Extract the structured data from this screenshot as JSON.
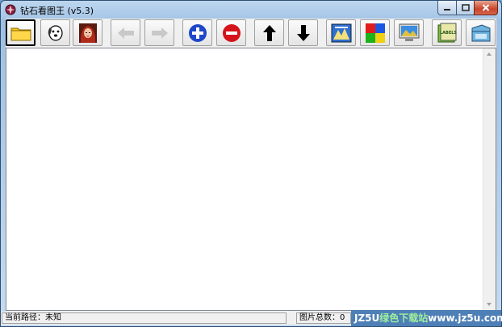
{
  "window": {
    "title": "钻石看图王 (v5.3)"
  },
  "toolbar": {
    "buttons": [
      {
        "name": "open-folder-button",
        "icon": "folder-icon"
      },
      {
        "name": "dog-button",
        "icon": "dog-icon"
      },
      {
        "name": "portrait-button",
        "icon": "portrait-icon"
      },
      {
        "name": "previous-button",
        "icon": "arrow-left-icon"
      },
      {
        "name": "next-button",
        "icon": "arrow-right-icon"
      },
      {
        "name": "zoom-in-button",
        "icon": "plus-circle-icon"
      },
      {
        "name": "zoom-out-button",
        "icon": "minus-circle-icon"
      },
      {
        "name": "move-up-button",
        "icon": "arrow-up-icon"
      },
      {
        "name": "move-down-button",
        "icon": "arrow-down-icon"
      },
      {
        "name": "slideshow-button",
        "icon": "slideshow-icon"
      },
      {
        "name": "colors-button",
        "icon": "color-squares-icon"
      },
      {
        "name": "monitor-button",
        "icon": "monitor-icon"
      },
      {
        "name": "labels-button",
        "icon": "labels-book-icon"
      },
      {
        "name": "folder-tab-button",
        "icon": "folder-tab-icon"
      }
    ],
    "labels_text": "LABELS"
  },
  "statusbar": {
    "path_label": "当前路径：未知",
    "count_label": "图片总数：",
    "count_value": "0"
  },
  "watermark": {
    "brand": "JZ5U",
    "text": "绿色下载站",
    "url": "www.jz5u.com"
  },
  "colors": {
    "title_bar": "#a9c8e8",
    "close_button": "#c7442a",
    "zoom_in_blue": "#1f47c8",
    "zoom_out_red": "#d4141a",
    "watermark_bg": "#4e7fb7"
  }
}
